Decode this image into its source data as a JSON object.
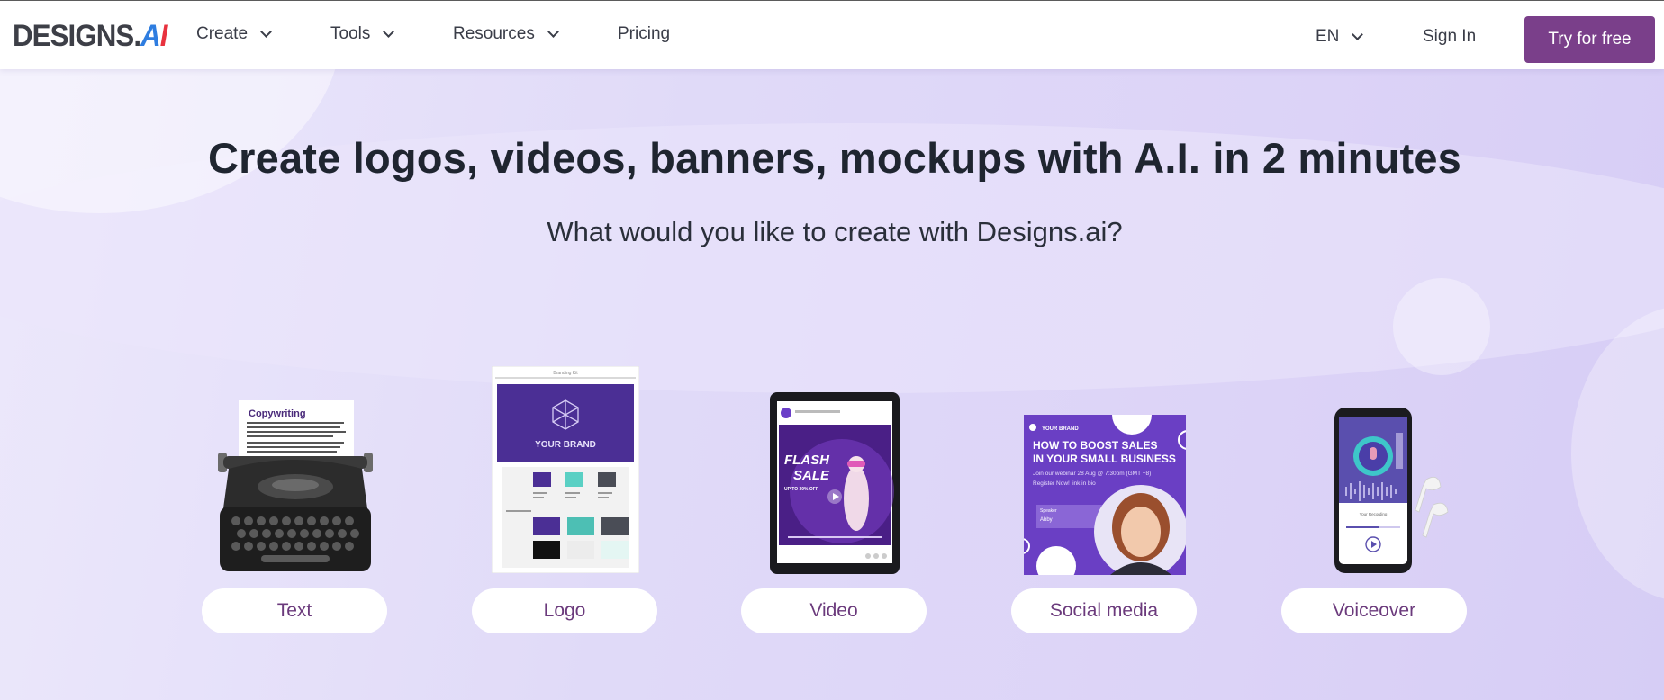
{
  "brand": {
    "name": "DESIGNS.",
    "ai": "AI",
    "colors": {
      "primary_button": "#7a3f8a",
      "hero_bg": "#e3dcf8",
      "text": "#1f2530"
    }
  },
  "nav": {
    "items": [
      {
        "label": "Create",
        "has_dropdown": true
      },
      {
        "label": "Tools",
        "has_dropdown": true
      },
      {
        "label": "Resources",
        "has_dropdown": true
      },
      {
        "label": "Pricing",
        "has_dropdown": false
      }
    ],
    "language": "EN",
    "sign_in": "Sign In",
    "cta": "Try for free"
  },
  "hero": {
    "headline": "Create logos, videos, banners, mockups with A.I. in 2 minutes",
    "subheadline": "What would you like to create with Designs.ai?"
  },
  "options": [
    {
      "label": "Text",
      "icon": "typewriter-icon",
      "preview_title": "Copywriting"
    },
    {
      "label": "Logo",
      "icon": "brand-sheet-icon",
      "preview_title": "YOUR BRAND",
      "preview_header": "Branding Kit"
    },
    {
      "label": "Video",
      "icon": "tablet-video-icon",
      "preview_title": "FLASH SALE",
      "preview_sub": "UP TO 30% OFF"
    },
    {
      "label": "Social media",
      "icon": "social-post-icon",
      "preview_brand": "YOUR BRAND",
      "preview_title": "HOW TO BOOST SALES IN YOUR SMALL BUSINESS",
      "preview_sub": "Join our webinar 28 Aug @ 7:30pm (GMT +8)",
      "preview_sub2": "Register Now! link in bio",
      "speaker_label": "Speaker",
      "speaker_name": "Abby"
    },
    {
      "label": "Voiceover",
      "icon": "phone-voice-icon",
      "preview_title": "Your Recording"
    }
  ]
}
